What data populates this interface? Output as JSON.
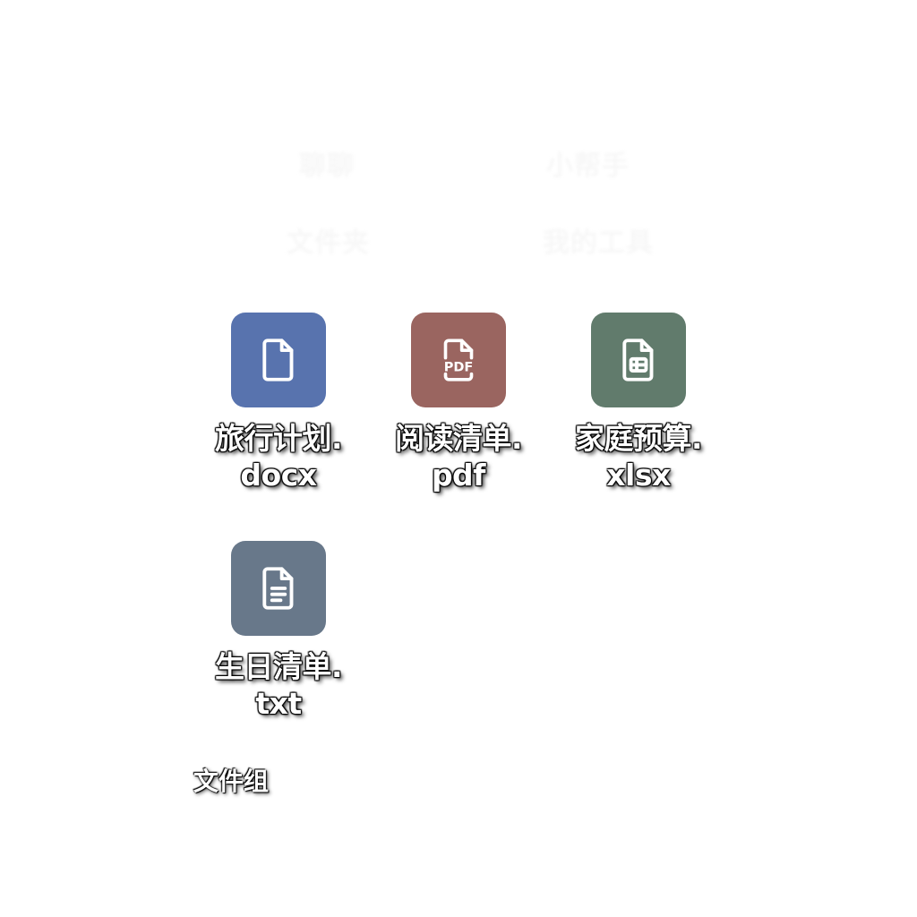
{
  "background_ghost_text": [
    "聊聊",
    "小帮手",
    "文件夹",
    "我的工具"
  ],
  "files": [
    {
      "label": "旅行计划.docx",
      "icon": "document-icon",
      "color": "#5873ae"
    },
    {
      "label": "阅读清单.pdf",
      "icon": "pdf-icon",
      "color": "#9a6560"
    },
    {
      "label": "家庭预算.xlsx",
      "icon": "spreadsheet-icon",
      "color": "#617b6c"
    },
    {
      "label": "生日清单.txt",
      "icon": "text-file-icon",
      "color": "#68788a"
    }
  ],
  "group_label": "文件组"
}
